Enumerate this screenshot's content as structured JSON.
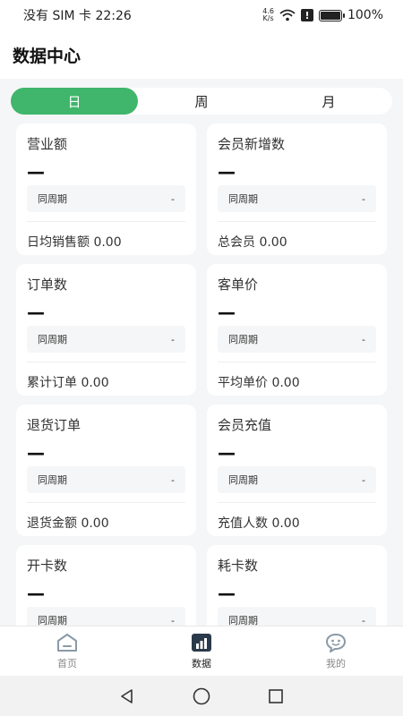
{
  "status_bar": {
    "carrier": "没有 SIM 卡",
    "time": "22:26",
    "speed_value": "4.6",
    "speed_unit": "K/s",
    "alert": "!",
    "battery": "100%"
  },
  "header": {
    "title": "数据中心"
  },
  "tabs": [
    {
      "label": "日",
      "active": true
    },
    {
      "label": "周",
      "active": false
    },
    {
      "label": "月",
      "active": false
    }
  ],
  "cards": [
    {
      "title": "营业额",
      "value": "—",
      "compare_label": "同周期",
      "compare_value": "-",
      "footer": "日均销售额 0.00"
    },
    {
      "title": "会员新增数",
      "value": "—",
      "compare_label": "同周期",
      "compare_value": "-",
      "footer": "总会员 0.00"
    },
    {
      "title": "订单数",
      "value": "—",
      "compare_label": "同周期",
      "compare_value": "-",
      "footer": "累计订单 0.00"
    },
    {
      "title": "客单价",
      "value": "—",
      "compare_label": "同周期",
      "compare_value": "-",
      "footer": "平均单价 0.00"
    },
    {
      "title": "退货订单",
      "value": "—",
      "compare_label": "同周期",
      "compare_value": "-",
      "footer": "退货金额 0.00"
    },
    {
      "title": "会员充值",
      "value": "—",
      "compare_label": "同周期",
      "compare_value": "-",
      "footer": "充值人数 0.00"
    },
    {
      "title": "开卡数",
      "value": "—",
      "compare_label": "同周期",
      "compare_value": "-",
      "footer": ""
    },
    {
      "title": "耗卡数",
      "value": "—",
      "compare_label": "同周期",
      "compare_value": "-",
      "footer": ""
    }
  ],
  "tabbar": [
    {
      "label": "首页",
      "icon": "home-icon",
      "active": false
    },
    {
      "label": "数据",
      "icon": "chart-icon",
      "active": true
    },
    {
      "label": "我的",
      "icon": "chat-face-icon",
      "active": false
    }
  ],
  "colors": {
    "accent": "#3fb66b",
    "active_tab_icon": "#2b3a4a",
    "inactive_icon": "#8a9aa8"
  }
}
